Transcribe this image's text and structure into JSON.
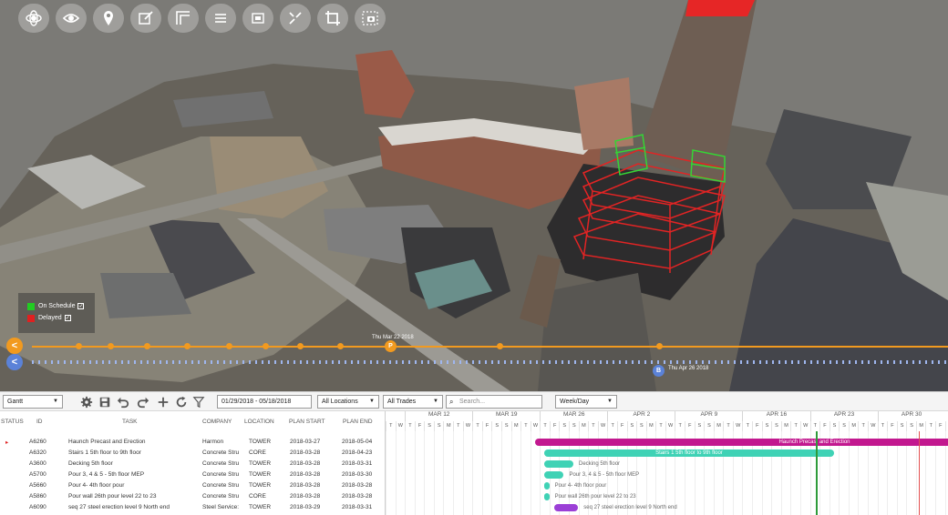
{
  "viewport": {
    "tools": [
      {
        "name": "orbit-icon"
      },
      {
        "name": "eye-icon"
      },
      {
        "name": "location-pin-icon"
      },
      {
        "name": "edit-icon"
      },
      {
        "name": "section-icon"
      },
      {
        "name": "list-icon"
      },
      {
        "name": "frame-icon"
      },
      {
        "name": "measure-icon"
      },
      {
        "name": "crop-icon"
      },
      {
        "name": "screenshot-icon"
      }
    ],
    "legend": {
      "items": [
        {
          "label": "On Schedule",
          "color": "#22cc22"
        },
        {
          "label": "Delayed",
          "color": "#e02020"
        }
      ]
    },
    "timeline": {
      "orange_button": "<",
      "blue_button": "<",
      "orange_pin": "P",
      "blue_pin": "B",
      "orange_date": "Thu Mar 22 2018",
      "blue_date": "Thu Apr 26 2018"
    }
  },
  "toolbar": {
    "view_select": "Gantt",
    "date_range": "01/29/2018 - 05/18/2018",
    "locations_select": "All Locations",
    "trades_select": "All Trades",
    "search_placeholder": "Search...",
    "scale_select": "Week/Day"
  },
  "table": {
    "headers": {
      "status": "STATUS",
      "id": "ID",
      "task": "TASK",
      "company": "COMPANY",
      "location": "LOCATION",
      "plan_start": "PLAN START",
      "plan_end": "PLAN END"
    },
    "rows": [
      {
        "status": "▸",
        "id": "A6260",
        "task": "Haunch Precast and Erection",
        "company": "Harmon",
        "location": "TOWER",
        "start": "2018-03-27",
        "end": "2018-05-04"
      },
      {
        "status": "",
        "id": "A6320",
        "task": "Stairs 1 5th floor to 9th floor",
        "company": "Concrete Stru",
        "location": "CORE",
        "start": "2018-03-28",
        "end": "2018-04-23"
      },
      {
        "status": "",
        "id": "A3600",
        "task": "Decking 5th floor",
        "company": "Concrete Stru",
        "location": "TOWER",
        "start": "2018-03-28",
        "end": "2018-03-31"
      },
      {
        "status": "",
        "id": "A5700",
        "task": "Pour 3, 4 & 5 - 5th floor MEP",
        "company": "Concrete Stru",
        "location": "TOWER",
        "start": "2018-03-28",
        "end": "2018-03-30"
      },
      {
        "status": "",
        "id": "A5660",
        "task": "Pour 4- 4th floor pour",
        "company": "Concrete Stru",
        "location": "TOWER",
        "start": "2018-03-28",
        "end": "2018-03-28"
      },
      {
        "status": "",
        "id": "A5860",
        "task": "Pour wall 26th pour level 22 to 23",
        "company": "Concrete Stru",
        "location": "CORE",
        "start": "2018-03-28",
        "end": "2018-03-28"
      },
      {
        "status": "",
        "id": "A6090",
        "task": "seq 27 steel erection level 9 North end",
        "company": "Steel Service:",
        "location": "TOWER",
        "start": "2018-03-29",
        "end": "2018-03-31"
      }
    ]
  },
  "gantt": {
    "weeks": [
      "MAR 12",
      "MAR 19",
      "MAR 26",
      "APR 2",
      "APR 9",
      "APR 16",
      "APR 23",
      "APR 30"
    ],
    "day_letters": [
      "T",
      "W",
      "T",
      "F",
      "S",
      "S",
      "M",
      "T",
      "W",
      "T",
      "F",
      "S",
      "S",
      "M",
      "T",
      "W",
      "T",
      "F",
      "S",
      "S",
      "M",
      "T",
      "W",
      "T",
      "F",
      "S",
      "S",
      "M",
      "T",
      "W",
      "T",
      "F",
      "S",
      "S",
      "M",
      "T",
      "W",
      "T",
      "F",
      "S",
      "S",
      "M",
      "T",
      "W",
      "T",
      "F",
      "S",
      "S",
      "M",
      "T",
      "W",
      "T",
      "F",
      "S",
      "S",
      "M",
      "T",
      "F",
      "S",
      "S"
    ],
    "bars": [
      {
        "label": "Haunch Precast and Erection",
        "color": "#c2188f",
        "inside": true
      },
      {
        "label": "Stairs 1 5th floor to 9th floor",
        "color": "#3fd2b5",
        "inside": true
      },
      {
        "label": "Decking 5th floor",
        "color": "#3fd2b5",
        "inside": false
      },
      {
        "label": "Pour 3, 4 & 5 - 5th floor MEP",
        "color": "#3fd2b5",
        "inside": false
      },
      {
        "label": "Pour 4- 4th floor pour",
        "color": "#3fd2b5",
        "inside": false
      },
      {
        "label": "Pour wall 26th pour level 22 to 23",
        "color": "#3fd2b5",
        "inside": false
      },
      {
        "label": "seq 27 steel erection level 9 North end",
        "color": "#9b3fd6",
        "inside": false
      }
    ],
    "today_color": "#2e9b3a",
    "marker_color": "#e35050"
  }
}
